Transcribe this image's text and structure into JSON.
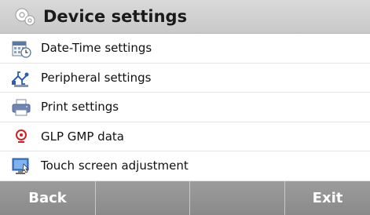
{
  "header": {
    "title": "Device settings",
    "icon": "gears-icon"
  },
  "menu": [
    {
      "label": "Date-Time settings",
      "icon": "calendar-clock-icon"
    },
    {
      "label": "Peripheral settings",
      "icon": "usb-icon"
    },
    {
      "label": "Print settings",
      "icon": "printer-icon"
    },
    {
      "label": "GLP GMP data",
      "icon": "glp-badge-icon"
    },
    {
      "label": "Touch screen adjustment",
      "icon": "touch-monitor-icon"
    }
  ],
  "footer": {
    "back_label": "Back",
    "exit_label": "Exit"
  },
  "colors": {
    "header_bg": "#d0d0d0",
    "footer_bg": "#939393",
    "accent_red": "#d42020"
  }
}
